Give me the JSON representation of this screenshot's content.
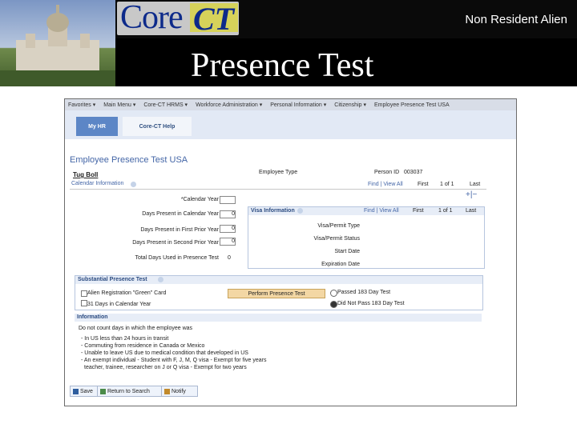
{
  "top_right": "Non Resident Alien",
  "title": "Presence Test",
  "logo": {
    "core": "Core",
    "ct": "CT"
  },
  "breadcrumb": [
    "Favorites ▾",
    "Main Menu ▾",
    "Core-CT HRMS ▾",
    "Workforce Administration ▾",
    "Personal Information ▾",
    "Citizenship ▾",
    "Employee Presence Test USA"
  ],
  "tabs": [
    "My HR",
    "Core-CT Help"
  ],
  "page_title": "Employee Presence Test USA",
  "employee_name": "Tug Boll",
  "employee_type_label": "Employee Type",
  "person_id_label": "Person ID",
  "person_id_value": "003037",
  "calendar": {
    "label": "Calendar Information",
    "find": "Find | View All",
    "nav": "First",
    "page": "1 of 1",
    "last": "Last",
    "fields": [
      {
        "label": "*Calendar Year",
        "value": ""
      },
      {
        "label": "Days Present in Calendar Year",
        "value": "0"
      },
      {
        "label": "Days Present in First Prior Year",
        "value": "0"
      },
      {
        "label": "Days Present in Second Prior Year",
        "value": "0"
      },
      {
        "label": "Total Days Used in Presence Test",
        "value": "0"
      }
    ]
  },
  "visa": {
    "label": "Visa Information",
    "find": "Find | View All",
    "nav": "First",
    "page": "1 of 1",
    "last": "Last",
    "fields": [
      "Visa/Permit Type",
      "Visa/Permit Status",
      "Start Date",
      "Expiration Date"
    ]
  },
  "substantial": {
    "label": "Substantial Presence Test",
    "checkbox1": "Alien Registration \"Green\" Card",
    "checkbox2": "31 Days in Calendar Year",
    "perform_button": "Perform Presence Test",
    "radio1": "Passed 183 Day Test",
    "radio2": "Did Not Pass 183 Day Test"
  },
  "information": {
    "label": "Information",
    "intro": "Do not count days in which the employee was",
    "lines": [
      "- In US less than 24 hours in transit",
      "- Commuting from residence in Canada or Mexico",
      "- Unable to leave US due to medical condition that developed in US",
      "- An exempt individual - Student with F, J, M, Q visa - Exempt for five years",
      "  teacher, trainee, researcher on J or Q visa - Exempt for two years"
    ]
  },
  "buttons": [
    "Save",
    "Return to Search",
    "Notify"
  ],
  "colors": {
    "banner": "#000000",
    "tab_active": "#5c86c6",
    "link": "#4466a7",
    "button": "#f3d7a4"
  }
}
